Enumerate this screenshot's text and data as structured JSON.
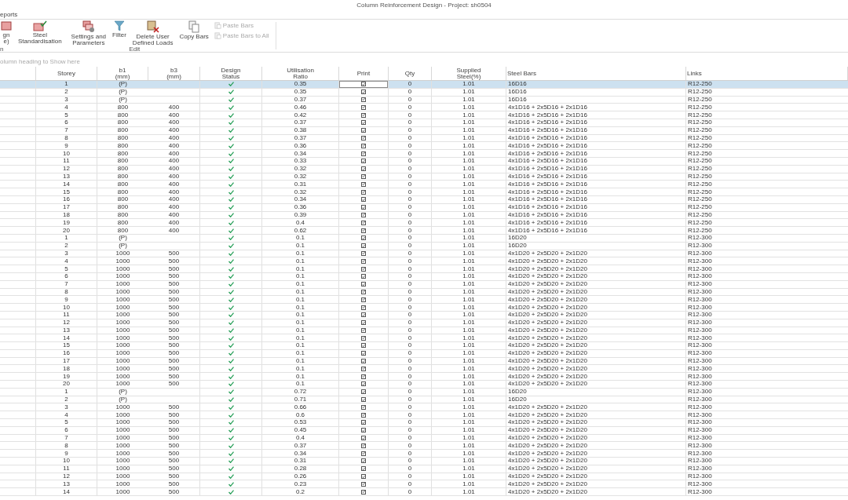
{
  "window": {
    "title": "Column Reinforcement Design - Project: sh0504"
  },
  "menu": [
    {
      "label": "eports"
    }
  ],
  "ribbon": {
    "buttons": [
      {
        "kind": "design",
        "label": "gn\ne)",
        "disabled": false
      },
      {
        "kind": "standard",
        "label": "Steel\nStandardisation",
        "disabled": false
      },
      {
        "kind": "settings",
        "label": "Settings and\nParameters",
        "disabled": false
      },
      {
        "kind": "filter",
        "label": "Filter",
        "disabled": false
      },
      {
        "kind": "delete",
        "label": "Delete User\nDefined Loads",
        "disabled": false
      },
      {
        "kind": "copy",
        "label": "Copy Bars",
        "disabled": false
      },
      {
        "kind": "paste",
        "label": "Paste Bars",
        "disabled": true
      },
      {
        "kind": "pasteall",
        "label": "Paste Bars to All",
        "disabled": true
      }
    ],
    "groups": [
      {
        "label": "n"
      },
      {
        "label": "Edit"
      }
    ]
  },
  "group_panel": {
    "placeholder": "olumn heading to Show here"
  },
  "table": {
    "columns": [
      "Storey",
      "b1\n(mm)",
      "b3\n(mm)",
      "Design\nStatus",
      "Utilisation\nRatio",
      "Print",
      "Qty",
      "Supplied\nSteel(%)",
      "Steel Bars",
      "Links"
    ],
    "rows": [
      {
        "storey": "1",
        "b1": "(P)",
        "passed": true,
        "ratio": "0.35",
        "print": true,
        "qty": "0",
        "steel": "1.01",
        "bars": "16D16",
        "links": "R12-250",
        "selected": true,
        "focused": true
      },
      {
        "storey": "2",
        "b1": "(P)",
        "passed": true,
        "ratio": "0.35",
        "print": true,
        "qty": "0",
        "steel": "1.01",
        "bars": "16D16",
        "links": "R12-250",
        "selected": false,
        "focused": false
      },
      {
        "storey": "3",
        "b1": "(P)",
        "passed": true,
        "ratio": "0.37",
        "print": true,
        "qty": "0",
        "steel": "1.01",
        "bars": "16D16",
        "links": "R12-250",
        "selected": false,
        "focused": false
      },
      {
        "storey": "4",
        "b1": "800",
        "b3": "400",
        "passed": true,
        "ratio": "0.46",
        "print": true,
        "qty": "0",
        "steel": "1.01",
        "bars": "4x1D16 + 2x5D16 + 2x1D16",
        "links": "R12-250",
        "selected": false,
        "focused": false
      },
      {
        "storey": "5",
        "b1": "800",
        "b3": "400",
        "passed": true,
        "ratio": "0.42",
        "print": true,
        "qty": "0",
        "steel": "1.01",
        "bars": "4x1D16 + 2x5D16 + 2x1D16",
        "links": "R12-250",
        "selected": false,
        "focused": false
      },
      {
        "storey": "6",
        "b1": "800",
        "b3": "400",
        "passed": true,
        "ratio": "0.37",
        "print": true,
        "qty": "0",
        "steel": "1.01",
        "bars": "4x1D16 + 2x5D16 + 2x1D16",
        "links": "R12-250",
        "selected": false,
        "focused": false
      },
      {
        "storey": "7",
        "b1": "800",
        "b3": "400",
        "passed": true,
        "ratio": "0.38",
        "print": true,
        "qty": "0",
        "steel": "1.01",
        "bars": "4x1D16 + 2x5D16 + 2x1D16",
        "links": "R12-250",
        "selected": false,
        "focused": false
      },
      {
        "storey": "8",
        "b1": "800",
        "b3": "400",
        "passed": true,
        "ratio": "0.37",
        "print": true,
        "qty": "0",
        "steel": "1.01",
        "bars": "4x1D16 + 2x5D16 + 2x1D16",
        "links": "R12-250",
        "selected": false,
        "focused": false
      },
      {
        "storey": "9",
        "b1": "800",
        "b3": "400",
        "passed": true,
        "ratio": "0.36",
        "print": true,
        "qty": "0",
        "steel": "1.01",
        "bars": "4x1D16 + 2x5D16 + 2x1D16",
        "links": "R12-250",
        "selected": false,
        "focused": false
      },
      {
        "storey": "10",
        "b1": "800",
        "b3": "400",
        "passed": true,
        "ratio": "0.34",
        "print": true,
        "qty": "0",
        "steel": "1.01",
        "bars": "4x1D16 + 2x5D16 + 2x1D16",
        "links": "R12-250",
        "selected": false,
        "focused": false
      },
      {
        "storey": "11",
        "b1": "800",
        "b3": "400",
        "passed": true,
        "ratio": "0.33",
        "print": true,
        "qty": "0",
        "steel": "1.01",
        "bars": "4x1D16 + 2x5D16 + 2x1D16",
        "links": "R12-250",
        "selected": false,
        "focused": false
      },
      {
        "storey": "12",
        "b1": "800",
        "b3": "400",
        "passed": true,
        "ratio": "0.32",
        "print": true,
        "qty": "0",
        "steel": "1.01",
        "bars": "4x1D16 + 2x5D16 + 2x1D16",
        "links": "R12-250",
        "selected": false,
        "focused": false
      },
      {
        "storey": "13",
        "b1": "800",
        "b3": "400",
        "passed": true,
        "ratio": "0.32",
        "print": true,
        "qty": "0",
        "steel": "1.01",
        "bars": "4x1D16 + 2x5D16 + 2x1D16",
        "links": "R12-250",
        "selected": false,
        "focused": false
      },
      {
        "storey": "14",
        "b1": "800",
        "b3": "400",
        "passed": true,
        "ratio": "0.31",
        "print": true,
        "qty": "0",
        "steel": "1.01",
        "bars": "4x1D16 + 2x5D16 + 2x1D16",
        "links": "R12-250",
        "selected": false,
        "focused": false
      },
      {
        "storey": "15",
        "b1": "800",
        "b3": "400",
        "passed": true,
        "ratio": "0.32",
        "print": true,
        "qty": "0",
        "steel": "1.01",
        "bars": "4x1D16 + 2x5D16 + 2x1D16",
        "links": "R12-250",
        "selected": false,
        "focused": false
      },
      {
        "storey": "16",
        "b1": "800",
        "b3": "400",
        "passed": true,
        "ratio": "0.34",
        "print": true,
        "qty": "0",
        "steel": "1.01",
        "bars": "4x1D16 + 2x5D16 + 2x1D16",
        "links": "R12-250",
        "selected": false,
        "focused": false
      },
      {
        "storey": "17",
        "b1": "800",
        "b3": "400",
        "passed": true,
        "ratio": "0.36",
        "print": true,
        "qty": "0",
        "steel": "1.01",
        "bars": "4x1D16 + 2x5D16 + 2x1D16",
        "links": "R12-250",
        "selected": false,
        "focused": false
      },
      {
        "storey": "18",
        "b1": "800",
        "b3": "400",
        "passed": true,
        "ratio": "0.39",
        "print": true,
        "qty": "0",
        "steel": "1.01",
        "bars": "4x1D16 + 2x5D16 + 2x1D16",
        "links": "R12-250",
        "selected": false,
        "focused": false
      },
      {
        "storey": "19",
        "b1": "800",
        "b3": "400",
        "passed": true,
        "ratio": "0.4",
        "print": true,
        "qty": "0",
        "steel": "1.01",
        "bars": "4x1D16 + 2x5D16 + 2x1D16",
        "links": "R12-250",
        "selected": false,
        "focused": false
      },
      {
        "storey": "20",
        "b1": "800",
        "b3": "400",
        "passed": true,
        "ratio": "0.62",
        "print": true,
        "qty": "0",
        "steel": "1.01",
        "bars": "4x1D16 + 2x5D16 + 2x1D16",
        "links": "R12-250",
        "selected": false,
        "focused": false
      },
      {
        "storey": "1",
        "b1": "(P)",
        "passed": true,
        "ratio": "0.1",
        "print": true,
        "qty": "0",
        "steel": "1.01",
        "bars": "16D20",
        "links": "R12-300",
        "selected": false,
        "focused": false
      },
      {
        "storey": "2",
        "b1": "(P)",
        "passed": true,
        "ratio": "0.1",
        "print": true,
        "qty": "0",
        "steel": "1.01",
        "bars": "16D20",
        "links": "R12-300",
        "selected": false,
        "focused": false
      },
      {
        "storey": "3",
        "b1": "1000",
        "b3": "500",
        "passed": true,
        "ratio": "0.1",
        "print": true,
        "qty": "0",
        "steel": "1.01",
        "bars": "4x1D20 + 2x5D20 + 2x1D20",
        "links": "R12-300",
        "selected": false,
        "focused": false
      },
      {
        "storey": "4",
        "b1": "1000",
        "b3": "500",
        "passed": true,
        "ratio": "0.1",
        "print": true,
        "qty": "0",
        "steel": "1.01",
        "bars": "4x1D20 + 2x5D20 + 2x1D20",
        "links": "R12-300",
        "selected": false,
        "focused": false
      },
      {
        "storey": "5",
        "b1": "1000",
        "b3": "500",
        "passed": true,
        "ratio": "0.1",
        "print": true,
        "qty": "0",
        "steel": "1.01",
        "bars": "4x1D20 + 2x5D20 + 2x1D20",
        "links": "R12-300",
        "selected": false,
        "focused": false
      },
      {
        "storey": "6",
        "b1": "1000",
        "b3": "500",
        "passed": true,
        "ratio": "0.1",
        "print": true,
        "qty": "0",
        "steel": "1.01",
        "bars": "4x1D20 + 2x5D20 + 2x1D20",
        "links": "R12-300",
        "selected": false,
        "focused": false
      },
      {
        "storey": "7",
        "b1": "1000",
        "b3": "500",
        "passed": true,
        "ratio": "0.1",
        "print": true,
        "qty": "0",
        "steel": "1.01",
        "bars": "4x1D20 + 2x5D20 + 2x1D20",
        "links": "R12-300",
        "selected": false,
        "focused": false
      },
      {
        "storey": "8",
        "b1": "1000",
        "b3": "500",
        "passed": true,
        "ratio": "0.1",
        "print": true,
        "qty": "0",
        "steel": "1.01",
        "bars": "4x1D20 + 2x5D20 + 2x1D20",
        "links": "R12-300",
        "selected": false,
        "focused": false
      },
      {
        "storey": "9",
        "b1": "1000",
        "b3": "500",
        "passed": true,
        "ratio": "0.1",
        "print": true,
        "qty": "0",
        "steel": "1.01",
        "bars": "4x1D20 + 2x5D20 + 2x1D20",
        "links": "R12-300",
        "selected": false,
        "focused": false
      },
      {
        "storey": "10",
        "b1": "1000",
        "b3": "500",
        "passed": true,
        "ratio": "0.1",
        "print": true,
        "qty": "0",
        "steel": "1.01",
        "bars": "4x1D20 + 2x5D20 + 2x1D20",
        "links": "R12-300",
        "selected": false,
        "focused": false
      },
      {
        "storey": "11",
        "b1": "1000",
        "b3": "500",
        "passed": true,
        "ratio": "0.1",
        "print": true,
        "qty": "0",
        "steel": "1.01",
        "bars": "4x1D20 + 2x5D20 + 2x1D20",
        "links": "R12-300",
        "selected": false,
        "focused": false
      },
      {
        "storey": "12",
        "b1": "1000",
        "b3": "500",
        "passed": true,
        "ratio": "0.1",
        "print": true,
        "qty": "0",
        "steel": "1.01",
        "bars": "4x1D20 + 2x5D20 + 2x1D20",
        "links": "R12-300",
        "selected": false,
        "focused": false
      },
      {
        "storey": "13",
        "b1": "1000",
        "b3": "500",
        "passed": true,
        "ratio": "0.1",
        "print": true,
        "qty": "0",
        "steel": "1.01",
        "bars": "4x1D20 + 2x5D20 + 2x1D20",
        "links": "R12-300",
        "selected": false,
        "focused": false
      },
      {
        "storey": "14",
        "b1": "1000",
        "b3": "500",
        "passed": true,
        "ratio": "0.1",
        "print": true,
        "qty": "0",
        "steel": "1.01",
        "bars": "4x1D20 + 2x5D20 + 2x1D20",
        "links": "R12-300",
        "selected": false,
        "focused": false
      },
      {
        "storey": "15",
        "b1": "1000",
        "b3": "500",
        "passed": true,
        "ratio": "0.1",
        "print": true,
        "qty": "0",
        "steel": "1.01",
        "bars": "4x1D20 + 2x5D20 + 2x1D20",
        "links": "R12-300",
        "selected": false,
        "focused": false
      },
      {
        "storey": "16",
        "b1": "1000",
        "b3": "500",
        "passed": true,
        "ratio": "0.1",
        "print": true,
        "qty": "0",
        "steel": "1.01",
        "bars": "4x1D20 + 2x5D20 + 2x1D20",
        "links": "R12-300",
        "selected": false,
        "focused": false
      },
      {
        "storey": "17",
        "b1": "1000",
        "b3": "500",
        "passed": true,
        "ratio": "0.1",
        "print": true,
        "qty": "0",
        "steel": "1.01",
        "bars": "4x1D20 + 2x5D20 + 2x1D20",
        "links": "R12-300",
        "selected": false,
        "focused": false
      },
      {
        "storey": "18",
        "b1": "1000",
        "b3": "500",
        "passed": true,
        "ratio": "0.1",
        "print": true,
        "qty": "0",
        "steel": "1.01",
        "bars": "4x1D20 + 2x5D20 + 2x1D20",
        "links": "R12-300",
        "selected": false,
        "focused": false
      },
      {
        "storey": "19",
        "b1": "1000",
        "b3": "500",
        "passed": true,
        "ratio": "0.1",
        "print": true,
        "qty": "0",
        "steel": "1.01",
        "bars": "4x1D20 + 2x5D20 + 2x1D20",
        "links": "R12-300",
        "selected": false,
        "focused": false
      },
      {
        "storey": "20",
        "b1": "1000",
        "b3": "500",
        "passed": true,
        "ratio": "0.1",
        "print": true,
        "qty": "0",
        "steel": "1.01",
        "bars": "4x1D20 + 2x5D20 + 2x1D20",
        "links": "R12-300",
        "selected": false,
        "focused": false
      },
      {
        "storey": "1",
        "b1": "(P)",
        "passed": true,
        "ratio": "0.72",
        "print": true,
        "qty": "0",
        "steel": "1.01",
        "bars": "16D20",
        "links": "R12-300",
        "selected": false,
        "focused": false
      },
      {
        "storey": "2",
        "b1": "(P)",
        "passed": true,
        "ratio": "0.71",
        "print": true,
        "qty": "0",
        "steel": "1.01",
        "bars": "16D20",
        "links": "R12-300",
        "selected": false,
        "focused": false
      },
      {
        "storey": "3",
        "b1": "1000",
        "b3": "500",
        "passed": true,
        "ratio": "0.66",
        "print": true,
        "qty": "0",
        "steel": "1.01",
        "bars": "4x1D20 + 2x5D20 + 2x1D20",
        "links": "R12-300",
        "selected": false,
        "focused": false
      },
      {
        "storey": "4",
        "b1": "1000",
        "b3": "500",
        "passed": true,
        "ratio": "0.6",
        "print": true,
        "qty": "0",
        "steel": "1.01",
        "bars": "4x1D20 + 2x5D20 + 2x1D20",
        "links": "R12-300",
        "selected": false,
        "focused": false
      },
      {
        "storey": "5",
        "b1": "1000",
        "b3": "500",
        "passed": true,
        "ratio": "0.53",
        "print": true,
        "qty": "0",
        "steel": "1.01",
        "bars": "4x1D20 + 2x5D20 + 2x1D20",
        "links": "R12-300",
        "selected": false,
        "focused": false
      },
      {
        "storey": "6",
        "b1": "1000",
        "b3": "500",
        "passed": true,
        "ratio": "0.45",
        "print": true,
        "qty": "0",
        "steel": "1.01",
        "bars": "4x1D20 + 2x5D20 + 2x1D20",
        "links": "R12-300",
        "selected": false,
        "focused": false
      },
      {
        "storey": "7",
        "b1": "1000",
        "b3": "500",
        "passed": true,
        "ratio": "0.4",
        "print": true,
        "qty": "0",
        "steel": "1.01",
        "bars": "4x1D20 + 2x5D20 + 2x1D20",
        "links": "R12-300",
        "selected": false,
        "focused": false
      },
      {
        "storey": "8",
        "b1": "1000",
        "b3": "500",
        "passed": true,
        "ratio": "0.37",
        "print": true,
        "qty": "0",
        "steel": "1.01",
        "bars": "4x1D20 + 2x5D20 + 2x1D20",
        "links": "R12-300",
        "selected": false,
        "focused": false
      },
      {
        "storey": "9",
        "b1": "1000",
        "b3": "500",
        "passed": true,
        "ratio": "0.34",
        "print": true,
        "qty": "0",
        "steel": "1.01",
        "bars": "4x1D20 + 2x5D20 + 2x1D20",
        "links": "R12-300",
        "selected": false,
        "focused": false
      },
      {
        "storey": "10",
        "b1": "1000",
        "b3": "500",
        "passed": true,
        "ratio": "0.31",
        "print": true,
        "qty": "0",
        "steel": "1.01",
        "bars": "4x1D20 + 2x5D20 + 2x1D20",
        "links": "R12-300",
        "selected": false,
        "focused": false
      },
      {
        "storey": "11",
        "b1": "1000",
        "b3": "500",
        "passed": true,
        "ratio": "0.28",
        "print": true,
        "qty": "0",
        "steel": "1.01",
        "bars": "4x1D20 + 2x5D20 + 2x1D20",
        "links": "R12-300",
        "selected": false,
        "focused": false
      },
      {
        "storey": "12",
        "b1": "1000",
        "b3": "500",
        "passed": true,
        "ratio": "0.26",
        "print": true,
        "qty": "0",
        "steel": "1.01",
        "bars": "4x1D20 + 2x5D20 + 2x1D20",
        "links": "R12-300",
        "selected": false,
        "focused": false
      },
      {
        "storey": "13",
        "b1": "1000",
        "b3": "500",
        "passed": true,
        "ratio": "0.23",
        "print": true,
        "qty": "0",
        "steel": "1.01",
        "bars": "4x1D20 + 2x5D20 + 2x1D20",
        "links": "R12-300",
        "selected": false,
        "focused": false
      },
      {
        "storey": "14",
        "b1": "1000",
        "b3": "500",
        "passed": true,
        "ratio": "0.2",
        "print": true,
        "qty": "0",
        "steel": "1.01",
        "bars": "4x1D20 + 2x5D20 + 2x1D20",
        "links": "R12-300",
        "selected": false,
        "focused": false
      }
    ]
  }
}
